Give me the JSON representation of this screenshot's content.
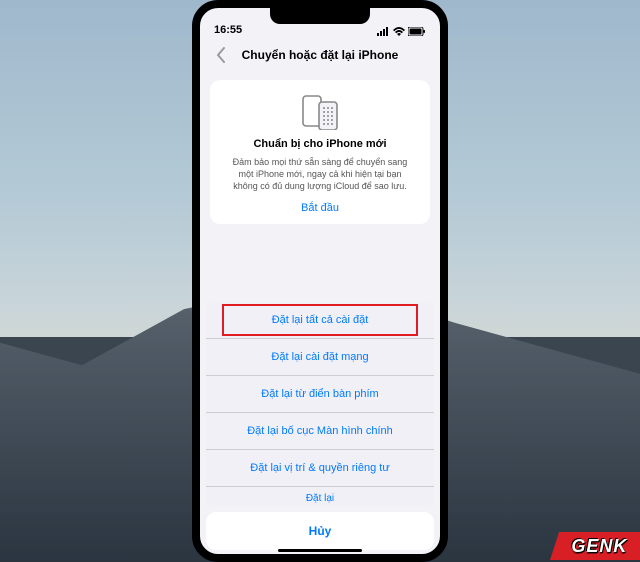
{
  "status": {
    "time": "16:55"
  },
  "nav": {
    "title": "Chuyển hoặc đặt lại iPhone"
  },
  "card": {
    "title": "Chuẩn bị cho iPhone mới",
    "description": "Đảm bảo mọi thứ sẵn sàng để chuyển sang một iPhone mới, ngay cả khi hiện tại bạn không có đủ dung lượng iCloud để sao lưu.",
    "cta": "Bắt đầu"
  },
  "sheet": {
    "items": [
      {
        "label": "Đặt lại tất cả cài đặt",
        "highlighted": true
      },
      {
        "label": "Đặt lại cài đặt mạng",
        "highlighted": false
      },
      {
        "label": "Đặt lại từ điển bàn phím",
        "highlighted": false
      },
      {
        "label": "Đặt lại bố cục Màn hình chính",
        "highlighted": false
      },
      {
        "label": "Đặt lại vị trí & quyền riêng tư",
        "highlighted": false
      }
    ],
    "partial": "Đặt lại",
    "cancel": "Hủy"
  },
  "watermark": "GENK"
}
